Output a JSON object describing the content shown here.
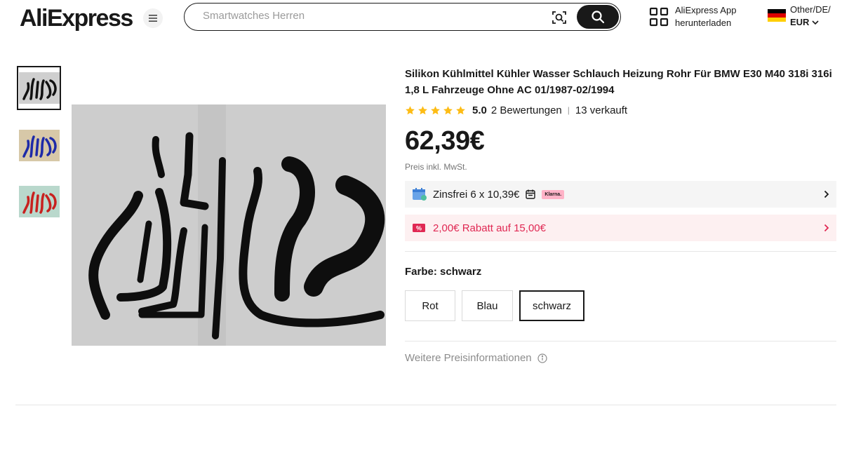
{
  "header": {
    "logo_text": "AliExpress",
    "search": {
      "placeholder": "Smartwatches Herren"
    },
    "app_line1": "AliExpress App",
    "app_line2": "herunterladen",
    "locale_line1": "Other/DE/",
    "locale_currency": "EUR"
  },
  "gallery": {
    "thumbnails": [
      "black-hoses",
      "blue-hoses",
      "red-hoses"
    ],
    "active_index": 0
  },
  "product": {
    "title": "Silikon Kühlmittel Kühler Wasser Schlauch Heizung Rohr Für BMW E30 M40 318i 316i 1,8 L Fahrzeuge Ohne AC 01/1987-02/1994",
    "rating_value": 5.0,
    "rating_score": "5.0",
    "reviews": "2 Bewertungen",
    "sold": "13 verkauft",
    "price": "62,39€",
    "tax_note": "Preis inkl. MwSt.",
    "installment": "Zinsfrei 6 x 10,39€",
    "installment_badge": "Klarna.",
    "coupon": "2,00€ Rabatt auf 15,00€",
    "color_label": "Farbe: ",
    "color_value": "schwarz",
    "color_options": [
      "Rot",
      "Blau",
      "schwarz"
    ],
    "selected_color": "schwarz",
    "more_info": "Weitere Preisinformationen"
  },
  "colors": {
    "accent_dark": "#191919",
    "star": "#fdbc15",
    "coupon_text": "#e02853",
    "coupon_bg": "#fdf0f1"
  }
}
